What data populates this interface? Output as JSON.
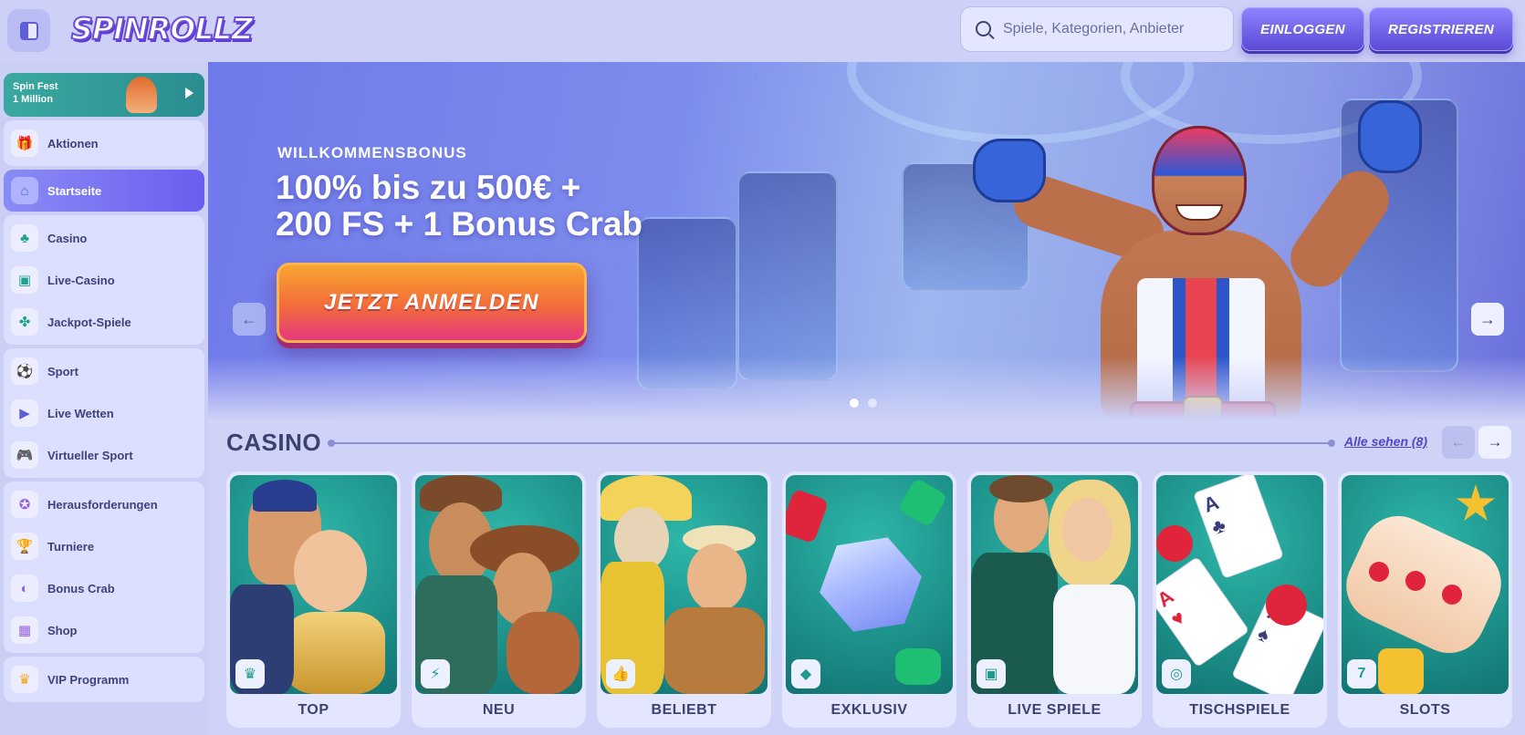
{
  "header": {
    "logo": "SPINROLLZ",
    "search_placeholder": "Spiele, Kategorien, Anbieter",
    "login": "EINLOGGEN",
    "register": "REGISTRIEREN"
  },
  "sidebar": {
    "promo": {
      "line1": "Spin Fest",
      "line2": "1 Million"
    },
    "groups": [
      [
        {
          "label": "Aktionen",
          "icon": "gift-icon"
        }
      ],
      [
        {
          "label": "Startseite",
          "icon": "home-icon",
          "active": true
        }
      ],
      [
        {
          "label": "Casino",
          "icon": "cherry-icon"
        },
        {
          "label": "Live-Casino",
          "icon": "live-card-icon"
        },
        {
          "label": "Jackpot-Spiele",
          "icon": "clover-icon"
        }
      ],
      [
        {
          "label": "Sport",
          "icon": "ball-icon"
        },
        {
          "label": "Live Wetten",
          "icon": "play-circle-icon"
        },
        {
          "label": "Virtueller Sport",
          "icon": "gamepad-icon"
        }
      ],
      [
        {
          "label": "Herausforderungen",
          "icon": "medal-icon"
        },
        {
          "label": "Turniere",
          "icon": "trophy-icon"
        },
        {
          "label": "Bonus Crab",
          "icon": "crab-icon"
        },
        {
          "label": "Shop",
          "icon": "shop-icon"
        }
      ],
      [
        {
          "label": "VIP Programm",
          "icon": "crown-icon"
        }
      ]
    ]
  },
  "hero": {
    "label": "WILLKOMMENSBONUS",
    "title_line1": "100% bis zu 500€ +",
    "title_line2": "200 FS + 1 Bonus Crab",
    "cta": "JETZT ANMELDEN",
    "slides": 2,
    "active_slide": 1
  },
  "casino": {
    "title": "CASINO",
    "see_all": "Alle sehen (8)",
    "categories": [
      {
        "label": "TOP",
        "icon": "crown-icon",
        "badge": "♛"
      },
      {
        "label": "NEU",
        "icon": "lightning-icon",
        "badge": "⚡"
      },
      {
        "label": "BELIEBT",
        "icon": "thumbs-up-icon",
        "badge": "👍"
      },
      {
        "label": "EXKLUSIV",
        "icon": "diamond-icon",
        "badge": "◆"
      },
      {
        "label": "LIVE SPIELE",
        "icon": "live-card-icon",
        "badge": "▣"
      },
      {
        "label": "TISCHSPIELE",
        "icon": "chip-icon",
        "badge": "◎"
      },
      {
        "label": "SLOTS",
        "icon": "slot-machine-icon",
        "badge": "7"
      }
    ]
  },
  "colors": {
    "accent": "#6a5df0",
    "cta_top": "#f7a531",
    "cta_bottom": "#e6397f",
    "card_teal": "#1c8f89"
  }
}
